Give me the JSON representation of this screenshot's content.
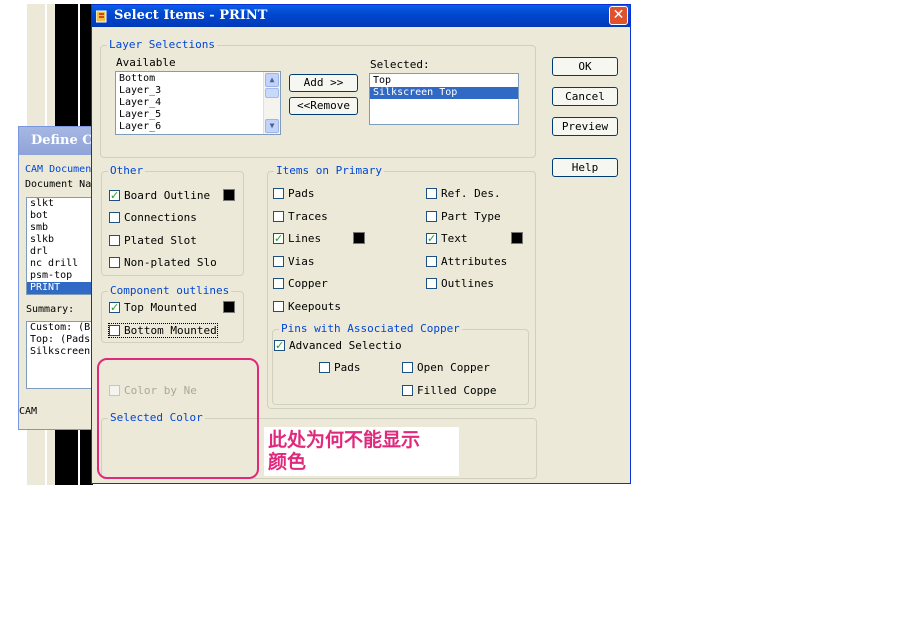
{
  "background": {
    "define_window": {
      "title": "Define C",
      "cam_docs_label": "CAM Documen",
      "doc_name_label": "Document Na",
      "documents": [
        "slkt",
        "bot",
        "smb",
        "slkb",
        "drl",
        "nc drill",
        "psm-top",
        "PRINT"
      ],
      "selected_document": "PRINT",
      "summary_label": "Summary:",
      "summary_lines": [
        "Custom: (B",
        "Top: (Pads",
        "Silkscreen"
      ],
      "footer_label": "CAM"
    }
  },
  "dialog": {
    "title": "Select Items - PRINT",
    "close_label": "✕",
    "layer_selections": {
      "group_label": "Layer Selections",
      "available_label": "Available",
      "available_items": [
        "Bottom",
        "Layer_3",
        "Layer_4",
        "Layer_5",
        "Layer_6"
      ],
      "add_label": "Add >>",
      "remove_label": "<<Remove",
      "selected_label": "Selected:",
      "selected_items": [
        "Top",
        "Silkscreen Top"
      ],
      "highlighted_item": "Silkscreen Top"
    },
    "buttons": {
      "ok": "OK",
      "cancel": "Cancel",
      "preview": "Preview",
      "help": "Help"
    },
    "other": {
      "group_label": "Other",
      "items": [
        {
          "label": "Board Outline",
          "checked": true,
          "color_swatch": true
        },
        {
          "label": "Connections",
          "checked": false,
          "color_swatch": false
        },
        {
          "label": "Plated Slot",
          "checked": false,
          "color_swatch": false
        },
        {
          "label": "Non-plated Slo",
          "checked": false,
          "color_swatch": false
        }
      ]
    },
    "component_outlines": {
      "group_label": "Component outlines",
      "items": [
        {
          "label": "Top Mounted",
          "checked": true,
          "color_swatch": true
        },
        {
          "label": "Bottom Mounted",
          "checked": false,
          "color_swatch": false
        }
      ]
    },
    "color_by_net": {
      "label": "Color by Ne",
      "checked": false,
      "disabled": true
    },
    "selected_color": {
      "group_label": "Selected Color"
    },
    "items_on_primary": {
      "group_label": "Items on Primary",
      "left": [
        {
          "label": "Pads",
          "checked": false
        },
        {
          "label": "Traces",
          "checked": false
        },
        {
          "label": "Lines",
          "checked": true,
          "color_swatch": true
        },
        {
          "label": "Vias",
          "checked": false
        },
        {
          "label": "Copper",
          "checked": false
        },
        {
          "label": "Keepouts",
          "checked": false
        }
      ],
      "right": [
        {
          "label": "Ref. Des.",
          "checked": false
        },
        {
          "label": "Part Type",
          "checked": false
        },
        {
          "label": "Text",
          "checked": true,
          "color_swatch": true
        },
        {
          "label": "Attributes",
          "checked": false
        },
        {
          "label": "Outlines",
          "checked": false
        }
      ]
    },
    "pins_with_copper": {
      "group_label": "Pins with Associated Copper",
      "advanced": {
        "label": "Advanced Selectio",
        "checked": true
      },
      "pads": {
        "label": "Pads",
        "checked": false
      },
      "open_copper": {
        "label": "Open Copper",
        "checked": false
      },
      "filled_copper": {
        "label": "Filled Coppe",
        "checked": false
      }
    }
  },
  "annotation": {
    "note_line1": "此处为何不能显示",
    "note_line2": "颜色",
    "color": "#e0297d"
  },
  "colors": {
    "titlebar": "#0048d0",
    "dialog_bg": "#ece9d8",
    "group_label": "#0046d5",
    "selection": "#316ac5"
  }
}
